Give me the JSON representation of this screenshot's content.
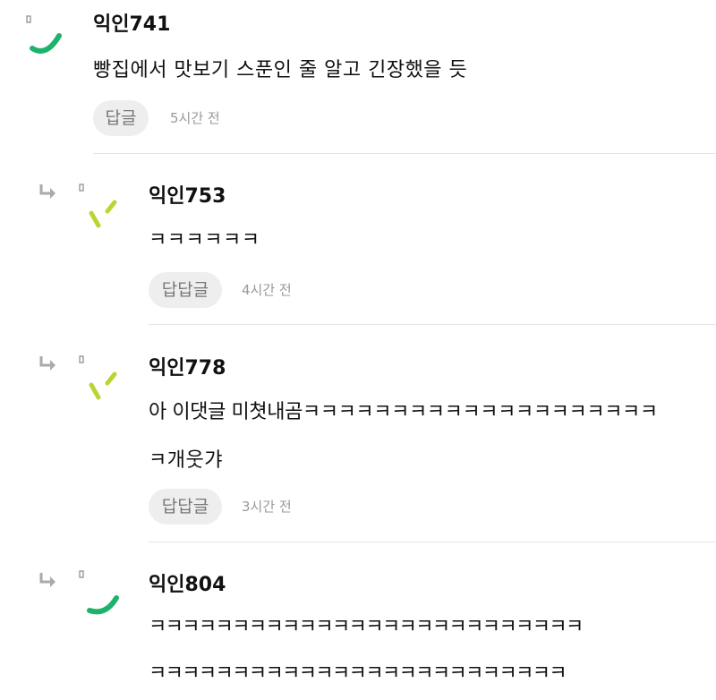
{
  "comments": [
    {
      "author": "익인741",
      "lines": [
        "빵집에서 맛보기 스푼인 줄 알고 긴장했을 듯"
      ],
      "reply_label": "답글",
      "time": "5시간 전",
      "avatar_icon": "green-arc-icon",
      "avatar_color": "#1db36b"
    },
    {
      "author": "익인753",
      "lines": [
        "ㅋㅋㅋㅋㅋㅋ"
      ],
      "reply_label": "답답글",
      "time": "4시간 전",
      "avatar_icon": "lime-ticks-icon",
      "avatar_color": "#b9d533"
    },
    {
      "author": "익인778",
      "lines": [
        "아 이댓글 미쳣내곰ㅋㅋㅋㅋㅋㅋㅋㅋㅋㅋㅋㅋㅋㅋㅋㅋㅋㅋㅋㅋ",
        "ㅋ개웃갸"
      ],
      "reply_label": "답답글",
      "time": "3시간 전",
      "avatar_icon": "lime-ticks-icon",
      "avatar_color": "#b9d533"
    },
    {
      "author": "익인804",
      "lines": [
        "ㅋㅋㅋㅋㅋㅋㅋㅋㅋㅋㅋㅋㅋㅋㅋㅋㅋㅋㅋㅋㅋㅋㅋㅋㅋㅋ",
        "ㅋㅋㅋㅋㅋㅋㅋㅋㅋㅋㅋㅋㅋㅋㅋㅋㅋㅋㅋㅋㅋㅋㅋㅋㅋ"
      ],
      "avatar_icon": "green-arc-icon",
      "avatar_color": "#1db36b"
    }
  ],
  "reply_arrow_icon": "reply-arrow-icon",
  "divider_color": "#e6e6e6"
}
